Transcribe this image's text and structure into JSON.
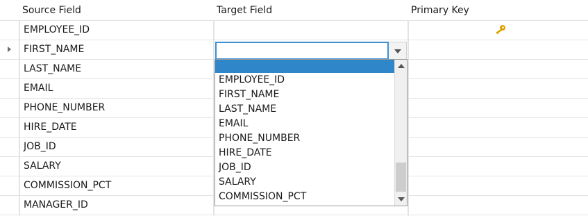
{
  "columns": {
    "source": "Source Field",
    "target": "Target Field",
    "primary_key": "Primary Key"
  },
  "rows": [
    {
      "source": "EMPLOYEE_ID",
      "primary_key": true
    },
    {
      "source": "FIRST_NAME",
      "current": true
    },
    {
      "source": "LAST_NAME"
    },
    {
      "source": "EMAIL"
    },
    {
      "source": "PHONE_NUMBER"
    },
    {
      "source": "HIRE_DATE"
    },
    {
      "source": "JOB_ID"
    },
    {
      "source": "SALARY"
    },
    {
      "source": "COMMISSION_PCT"
    },
    {
      "source": "MANAGER_ID"
    }
  ],
  "combo": {
    "value": ""
  },
  "dropdown_options": [
    "",
    "EMPLOYEE_ID",
    "FIRST_NAME",
    "LAST_NAME",
    "EMAIL",
    "PHONE_NUMBER",
    "HIRE_DATE",
    "JOB_ID",
    "SALARY",
    "COMMISSION_PCT"
  ],
  "icons": {
    "primary_key": "key-icon",
    "current_row": "row-indicator-icon"
  },
  "colors": {
    "selection": "#2f86c9",
    "focus_border": "#3d8fd1",
    "key_icon": "#e0a100",
    "grid_line": "#e3e3e3"
  }
}
